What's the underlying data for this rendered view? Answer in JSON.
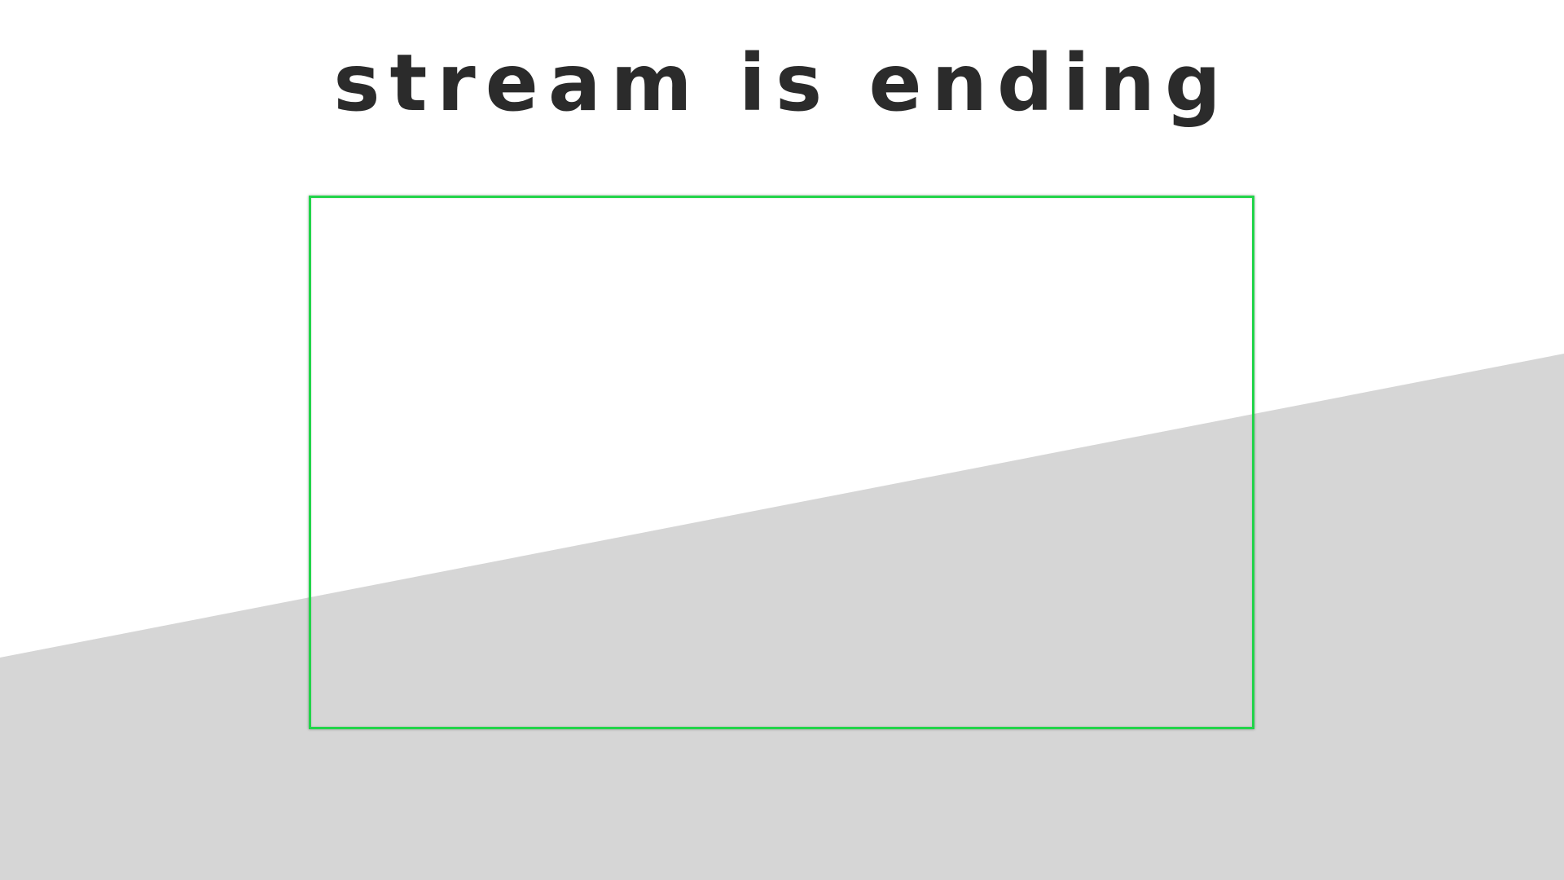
{
  "scene": {
    "title": "stream is ending",
    "background_color": "#ffffff",
    "band_color": "#d6d6d6",
    "frame_color": "#22d44a",
    "title_color": "#2b2b2b"
  }
}
